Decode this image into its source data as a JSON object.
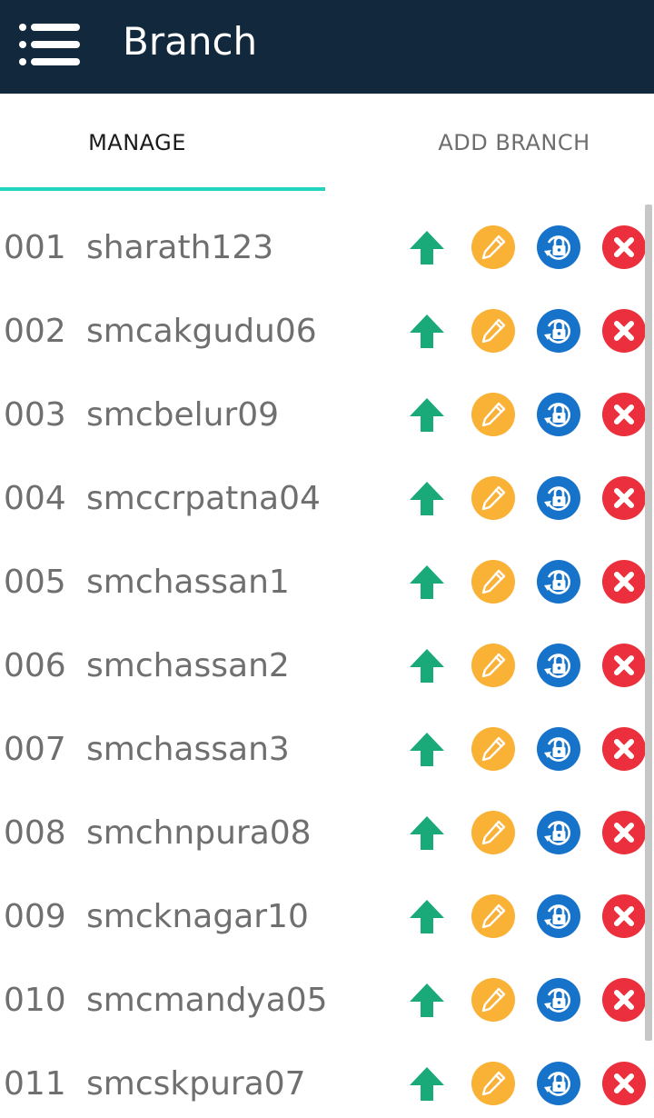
{
  "app_bar": {
    "title": "Branch",
    "menu_icon": "hamburger-menu-icon",
    "background": "#12293d"
  },
  "tabs": [
    {
      "label": "MANAGE",
      "selected": true
    },
    {
      "label": "ADD BRANCH",
      "selected": false
    }
  ],
  "accent_color": "#22d3c0",
  "row_actions": [
    {
      "icon": "arrow-up-icon",
      "color": "#1aaa7a"
    },
    {
      "icon": "pencil-edit-icon",
      "color": "#f9b136"
    },
    {
      "icon": "lock-rotate-icon",
      "color": "#1673c9"
    },
    {
      "icon": "close-icon",
      "color": "#eb2f3c"
    }
  ],
  "branches": [
    {
      "code": "001",
      "name": "sharath123"
    },
    {
      "code": "002",
      "name": "smcakgudu06"
    },
    {
      "code": "003",
      "name": "smcbelur09"
    },
    {
      "code": "004",
      "name": "smccrpatna04"
    },
    {
      "code": "005",
      "name": "smchassan1"
    },
    {
      "code": "006",
      "name": "smchassan2"
    },
    {
      "code": "007",
      "name": "smchassan3"
    },
    {
      "code": "008",
      "name": "smchnpura08"
    },
    {
      "code": "009",
      "name": "smcknagar10"
    },
    {
      "code": "010",
      "name": "smcmandya05"
    },
    {
      "code": "011",
      "name": "smcskpura07"
    }
  ]
}
